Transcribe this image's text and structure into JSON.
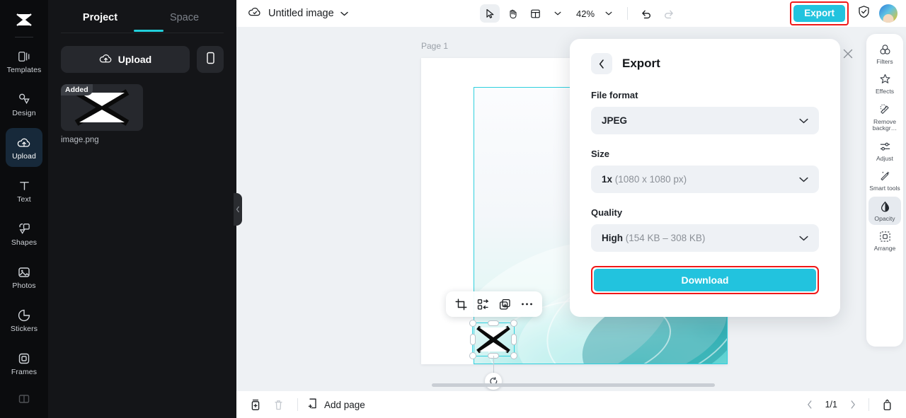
{
  "brand": {
    "accent": "#22c3de",
    "highlight": "#f01818",
    "dark_bg": "#0b0c0e"
  },
  "rail": {
    "logo_icon": "capcut-logo-icon",
    "items": [
      {
        "label": "Templates",
        "icon": "templates-icon",
        "active": false
      },
      {
        "label": "Design",
        "icon": "design-icon",
        "active": false
      },
      {
        "label": "Upload",
        "icon": "upload-cloud-icon",
        "active": true
      },
      {
        "label": "Text",
        "icon": "text-icon",
        "active": false
      },
      {
        "label": "Shapes",
        "icon": "shapes-icon",
        "active": false
      },
      {
        "label": "Photos",
        "icon": "photos-icon",
        "active": false
      },
      {
        "label": "Stickers",
        "icon": "stickers-icon",
        "active": false
      },
      {
        "label": "Frames",
        "icon": "frames-icon",
        "active": false
      }
    ]
  },
  "left_panel": {
    "tabs": [
      {
        "label": "Project",
        "active": true
      },
      {
        "label": "Space",
        "active": false
      }
    ],
    "upload_button": "Upload",
    "mobile_upload_icon": "mobile-phone-icon",
    "assets": [
      {
        "name": "image.png",
        "badge": "Added"
      }
    ]
  },
  "topbar": {
    "cloud_icon": "cloud-sync-icon",
    "doc_title": "Untitled image",
    "title_chevron_icon": "chevron-down-icon",
    "tools": [
      {
        "icon": "select-cursor-icon",
        "selected": true
      },
      {
        "icon": "hand-pan-icon",
        "selected": false
      },
      {
        "icon": "layout-grid-icon",
        "selected": false
      }
    ],
    "layout_chevron_icon": "chevron-down-icon",
    "zoom_level": "42%",
    "zoom_chevron_icon": "chevron-down-icon",
    "undo_icon": "undo-icon",
    "redo_icon": "redo-icon",
    "export_label": "Export",
    "shield_icon": "shield-check-icon",
    "avatar_name": "avatar"
  },
  "canvas": {
    "page_label": "Page 1",
    "float_toolbar": [
      {
        "icon": "crop-icon"
      },
      {
        "icon": "replace-media-icon"
      },
      {
        "icon": "duplicate-icon"
      },
      {
        "icon": "more-options-icon"
      }
    ],
    "rotate_icon": "rotate-icon"
  },
  "export_modal": {
    "back_icon": "chevron-left-icon",
    "title": "Export",
    "close_icon": "close-icon",
    "fields": [
      {
        "label": "File format",
        "value_strong": "JPEG",
        "value_muted": "",
        "chevron_icon": "chevron-down-icon"
      },
      {
        "label": "Size",
        "value_strong": "1x",
        "value_muted": "(1080 x 1080 px)",
        "chevron_icon": "chevron-down-icon"
      },
      {
        "label": "Quality",
        "value_strong": "High",
        "value_muted": "(154 KB – 308 KB)",
        "chevron_icon": "chevron-down-icon"
      }
    ],
    "download_label": "Download"
  },
  "right_tools": {
    "items": [
      {
        "label": "Filters",
        "icon": "filters-icon",
        "active": false
      },
      {
        "label": "Effects",
        "icon": "effects-icon",
        "active": false
      },
      {
        "label": "Remove backgr…",
        "icon": "remove-background-icon",
        "active": false
      },
      {
        "label": "Adjust",
        "icon": "adjust-sliders-icon",
        "active": false
      },
      {
        "label": "Smart tools",
        "icon": "smart-tools-icon",
        "active": false
      },
      {
        "label": "Opacity",
        "icon": "opacity-icon",
        "active": true
      },
      {
        "label": "Arrange",
        "icon": "arrange-icon",
        "active": false
      }
    ]
  },
  "bottombar": {
    "copy_page_icon": "copy-page-icon",
    "delete_page_icon": "trash-icon",
    "add_page_icon": "add-page-icon",
    "add_page_label": "Add page",
    "prev_icon": "chevron-left-icon",
    "page_indicator": "1/1",
    "next_icon": "chevron-right-icon",
    "panel_toggle_icon": "panel-toggle-icon"
  }
}
